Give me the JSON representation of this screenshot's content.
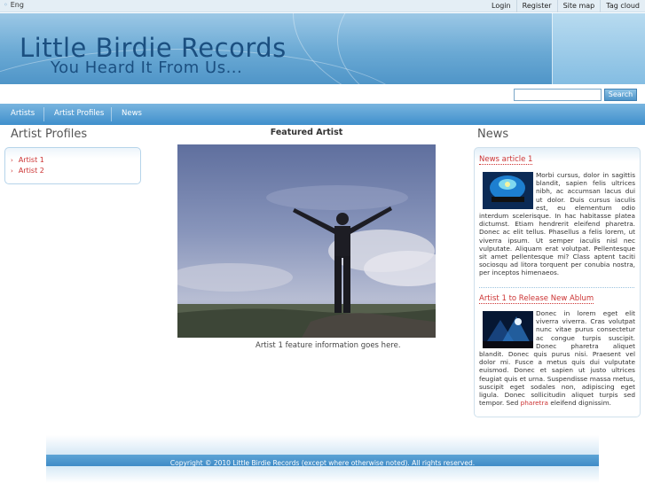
{
  "topbar": {
    "language": "Eng",
    "links": [
      "Login",
      "Register",
      "Site map",
      "Tag cloud"
    ]
  },
  "banner": {
    "title": "Little Birdie Records",
    "tagline": "You Heard It From Us..."
  },
  "search": {
    "value": "",
    "button_label": "Search"
  },
  "nav": {
    "items": [
      "Artists",
      "Artist Profiles",
      "News"
    ]
  },
  "left": {
    "heading": "Artist Profiles",
    "items": [
      "Artist 1",
      "Artist 2"
    ]
  },
  "featured": {
    "heading": "Featured Artist",
    "caption": "Artist 1 feature information goes here."
  },
  "news": {
    "heading": "News",
    "articles": [
      {
        "title": "News article 1",
        "body": "Morbi cursus, dolor in sagittis blandit, sapien felis ultrices nibh, ac accumsan lacus dui ut dolor. Duis cursus iaculis est, eu elementum odio interdum scelerisque. In hac habitasse platea dictumst. Etiam hendrerit eleifend pharetra. Donec ac elit tellus. Phasellus a felis lorem, ut viverra ipsum. Ut semper iaculis nisl nec vulputate. Aliquam erat volutpat. Pellentesque sit amet pellentesque mi? Class aptent taciti sociosqu ad litora torquent per conubia nostra, per inceptos himenaeos."
      },
      {
        "title": "Artist 1 to Release New Ablum",
        "body": "Donec in lorem eget elit viverra viverra. Cras volutpat nunc vitae purus consectetur ac congue turpis suscipit. Donec pharetra aliquet blandit. Donec quis purus nisi. Praesent vel dolor mi. Fusce a metus quis dui vulputate euismod. Donec et sapien ut justo ultrices feugiat quis et urna. Suspendisse massa metus, suscipit eget sodales non, adipiscing eget ligula. Donec sollicitudin aliquet turpis sed tempor. Sed",
        "link": "pharetra",
        "tail": "eleifend dignissim."
      }
    ]
  },
  "footer": {
    "copyright": "Copyright © 2010 Little Birdie Records (except where otherwise noted). All rights reserved."
  },
  "colors": {
    "accent": "#3f8fcc",
    "brand_text": "#1b4f80",
    "link": "#cc3333"
  }
}
